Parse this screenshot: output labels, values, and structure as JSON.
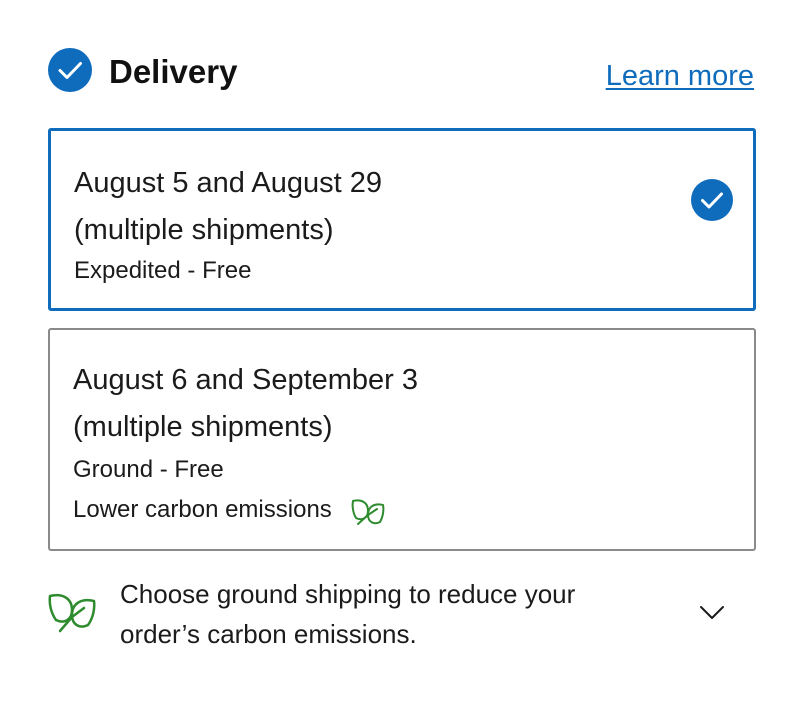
{
  "delivery": {
    "title": "Delivery",
    "learn_more": "Learn more",
    "options": [
      {
        "date_line1": "August 5 and August 29",
        "date_line2": "(multiple shipments)",
        "method": "Expedited - Free",
        "selected": true
      },
      {
        "date_line1": "August 6 and September 3",
        "date_line2": "(multiple shipments)",
        "method": "Ground - Free",
        "carbon_note": "Lower carbon emissions",
        "selected": false
      }
    ],
    "tip": {
      "line1": "Choose ground shipping to reduce your",
      "line2": "order’s carbon emissions."
    }
  },
  "icons": {
    "header_status": "check-circle-icon",
    "selected_option": "check-circle-icon",
    "carbon": "leaf-icon",
    "tip_leaf": "leaf-icon",
    "expand": "chevron-down-icon"
  },
  "colors": {
    "accent": "#0f6cbd",
    "eco_green": "#2e8b2e",
    "border": "#8a8a8a",
    "text": "#1b1b1b"
  }
}
